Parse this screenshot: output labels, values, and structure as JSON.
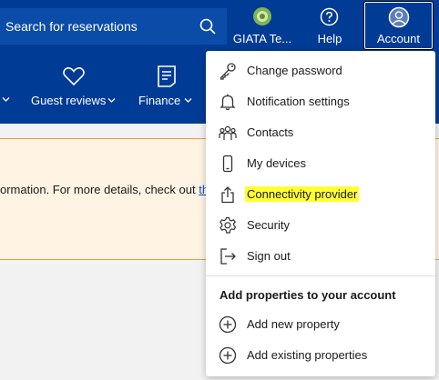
{
  "header": {
    "search_placeholder": "Search for reservations",
    "giata_label": "GIATA Te...",
    "help_label": "Help",
    "account_label": "Account"
  },
  "nav": {
    "guest_reviews": "Guest reviews",
    "finance": "Finance"
  },
  "banner": {
    "text": "ormation. For more details, check out ",
    "link": "th"
  },
  "account_menu": {
    "items": [
      {
        "label": "Change password",
        "icon": "key-icon"
      },
      {
        "label": "Notification settings",
        "icon": "bell-icon"
      },
      {
        "label": "Contacts",
        "icon": "people-icon"
      },
      {
        "label": "My devices",
        "icon": "phone-icon"
      },
      {
        "label": "Connectivity provider",
        "icon": "share-icon"
      },
      {
        "label": "Security",
        "icon": "gear-icon"
      },
      {
        "label": "Sign out",
        "icon": "sign-out-icon"
      }
    ],
    "heading": "Add properties to your account",
    "add_items": [
      {
        "label": "Add new property",
        "icon": "plus-circle-icon"
      },
      {
        "label": "Add existing properties",
        "icon": "plus-circle-icon"
      }
    ],
    "highlight_color": "#ffff33"
  },
  "colors": {
    "header_bg": "#003b95",
    "banner_bg": "#fff3e4",
    "banner_border": "#f09a3a",
    "link": "#0b52c4"
  }
}
